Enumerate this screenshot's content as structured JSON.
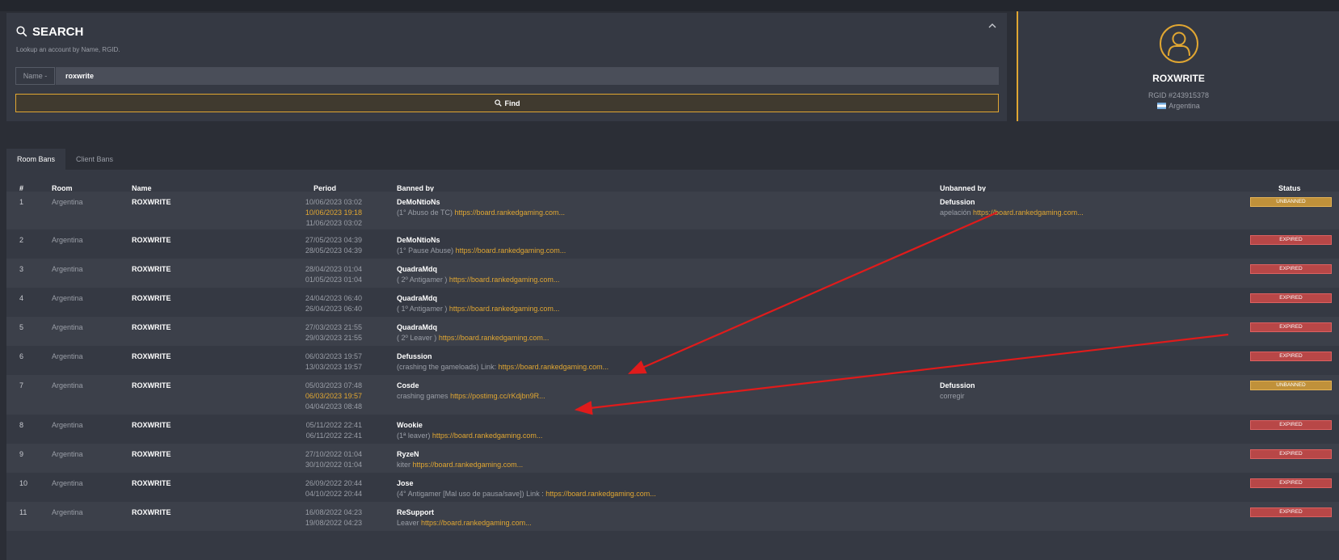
{
  "search": {
    "title": "SEARCH",
    "subtitle": "Lookup an account by Name, RGID.",
    "type_label": "Name -",
    "query": "roxwrite",
    "find_label": "Find"
  },
  "profile": {
    "name": "ROXWRITE",
    "rgid": "RGID #243915378",
    "country": "Argentina"
  },
  "tabs": [
    {
      "label": "Room Bans"
    },
    {
      "label": "Client Bans"
    }
  ],
  "table": {
    "headers": {
      "num": "#",
      "room": "Room",
      "name": "Name",
      "period": "Period",
      "banned_by": "Banned by",
      "unbanned_by": "Unbanned by",
      "status": "Status"
    },
    "rows": [
      {
        "num": "1",
        "room": "Argentina",
        "name": "ROXWRITE",
        "period": [
          "10/06/2023 03:02",
          "10/06/2023 19:18",
          "11/06/2023 03:02"
        ],
        "banned_by": "DeMoNtioNs",
        "reason": "(1° Abuso de TC)",
        "link": "https://board.rankedgaming.com...",
        "unbanned_by": "Defussion",
        "unban_reason": "apelación",
        "unban_link": "https://board.rankedgaming.com...",
        "status": "UNBANNED"
      },
      {
        "num": "2",
        "room": "Argentina",
        "name": "ROXWRITE",
        "period": [
          "27/05/2023 04:39",
          "28/05/2023 04:39"
        ],
        "banned_by": "DeMoNtioNs",
        "reason": "(1° Pause Abuse)",
        "link": "https://board.rankedgaming.com...",
        "status": "EXPIRED"
      },
      {
        "num": "3",
        "room": "Argentina",
        "name": "ROXWRITE",
        "period": [
          "28/04/2023 01:04",
          "01/05/2023 01:04"
        ],
        "banned_by": "QuadraMdq",
        "reason": "( 2º Antigamer )",
        "link": "https://board.rankedgaming.com...",
        "status": "EXPIRED"
      },
      {
        "num": "4",
        "room": "Argentina",
        "name": "ROXWRITE",
        "period": [
          "24/04/2023 06:40",
          "26/04/2023 06:40"
        ],
        "banned_by": "QuadraMdq",
        "reason": "( 1º Antigamer )",
        "link": "https://board.rankedgaming.com...",
        "status": "EXPIRED"
      },
      {
        "num": "5",
        "room": "Argentina",
        "name": "ROXWRITE",
        "period": [
          "27/03/2023 21:55",
          "29/03/2023 21:55"
        ],
        "banned_by": "QuadraMdq",
        "reason": "( 2º Leaver )",
        "link": "https://board.rankedgaming.com...",
        "status": "EXPIRED"
      },
      {
        "num": "6",
        "room": "Argentina",
        "name": "ROXWRITE",
        "period": [
          "06/03/2023 19:57",
          "13/03/2023 19:57"
        ],
        "banned_by": "Defussion",
        "reason": "(crashing the gameloads) Link:",
        "link": "https://board.rankedgaming.com...",
        "status": "EXPIRED"
      },
      {
        "num": "7",
        "room": "Argentina",
        "name": "ROXWRITE",
        "period": [
          "05/03/2023 07:48",
          "06/03/2023 19:57",
          "04/04/2023 08:48"
        ],
        "banned_by": "Cosde",
        "reason": "crashing games",
        "link": "https://postimg.cc/rKdjbn9R...",
        "unbanned_by": "Defussion",
        "unban_reason": "corregir",
        "status": "UNBANNED"
      },
      {
        "num": "8",
        "room": "Argentina",
        "name": "ROXWRITE",
        "period": [
          "05/11/2022 22:41",
          "06/11/2022 22:41"
        ],
        "banned_by": "Wookie",
        "reason": "(1ª leaver)",
        "link": "https://board.rankedgaming.com...",
        "status": "EXPIRED"
      },
      {
        "num": "9",
        "room": "Argentina",
        "name": "ROXWRITE",
        "period": [
          "27/10/2022 01:04",
          "30/10/2022 01:04"
        ],
        "banned_by": "RyzeN",
        "reason": "kiter",
        "link": "https://board.rankedgaming.com...",
        "status": "EXPIRED"
      },
      {
        "num": "10",
        "room": "Argentina",
        "name": "ROXWRITE",
        "period": [
          "26/09/2022 20:44",
          "04/10/2022 20:44"
        ],
        "banned_by": "Jose",
        "reason": "(4° Antigamer [Mal uso de pausa/save]) Link :",
        "link": "https://board.rankedgaming.com...",
        "status": "EXPIRED"
      },
      {
        "num": "11",
        "room": "Argentina",
        "name": "ROXWRITE",
        "period": [
          "16/08/2022 04:23",
          "19/08/2022 04:23"
        ],
        "banned_by": "ReSupport",
        "reason": "Leaver",
        "link": "https://board.rankedgaming.com...",
        "status": "EXPIRED"
      }
    ]
  },
  "colors": {
    "accent": "#e0a632",
    "expired": "#b84747",
    "unbanned": "#c0913a",
    "annotation": "#e01b1b"
  },
  "icons": [
    "search-icon",
    "chevron-up-icon",
    "user-avatar-icon",
    "flag-icon"
  ]
}
